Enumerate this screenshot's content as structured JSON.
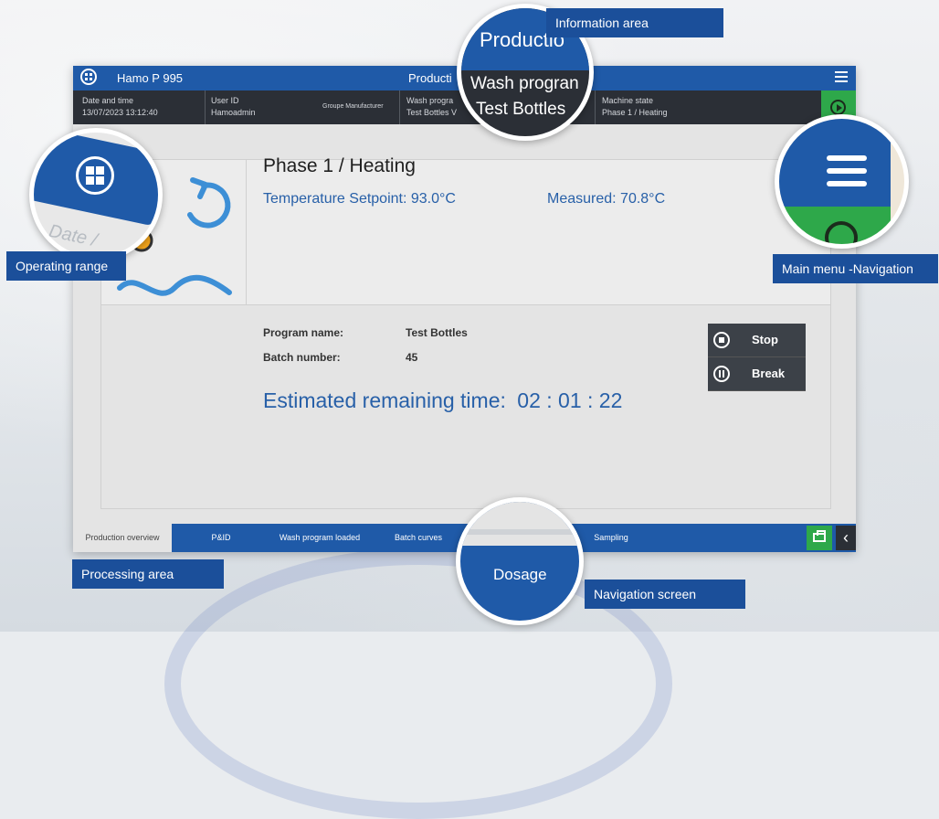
{
  "app": {
    "title": "Hamo P 995",
    "center_title": "Producti"
  },
  "info_bar": {
    "date_label": "Date and time",
    "date_value": "13/07/2023 13:12:40",
    "user_label": "User ID",
    "user_value": "Hamoadmin",
    "group_label": "Groupe Manufacturer",
    "wash_label": "Wash progra",
    "wash_value": "Test Bottles V",
    "state_label": "Machine state",
    "state_value": "Phase 1 / Heating"
  },
  "status": {
    "phase": "Phase 1 / Heating",
    "temperature": "Temperature Setpoint: 93.0°C",
    "measured": "Measured: 70.8°C"
  },
  "program": {
    "name_label": "Program name:",
    "name_value": "Test Bottles",
    "batch_label": "Batch number:",
    "batch_value": "45"
  },
  "controls": {
    "stop_label": "Stop",
    "break_label": "Break"
  },
  "estimate": {
    "label": "Estimated remaining time:",
    "value": "02 : 01 : 22"
  },
  "nav_tabs": [
    {
      "label": "Production overview"
    },
    {
      "label": "P&ID"
    },
    {
      "label": "Wash program loaded"
    },
    {
      "label": "Batch curves"
    },
    {
      "label": "Sampling"
    }
  ],
  "callouts": {
    "information_area": "Information area",
    "operating_range": "Operating range",
    "main_menu": "Main menu -Navigation",
    "processing_area": "Processing area",
    "navigation_screen": "Navigation screen"
  },
  "zoom_text": {
    "production": "Productio",
    "wash_program": "Wash progran",
    "test_bottles": "Test Bottles",
    "dosage": "Dosage",
    "date_fragment": "Date /"
  },
  "colors": {
    "brand_blue": "#1f5aa8",
    "accent_green": "#2ea84a",
    "dark_bar": "#2b2f36",
    "text_blue": "#2860a8",
    "icon_orange": "#f3a51b"
  }
}
